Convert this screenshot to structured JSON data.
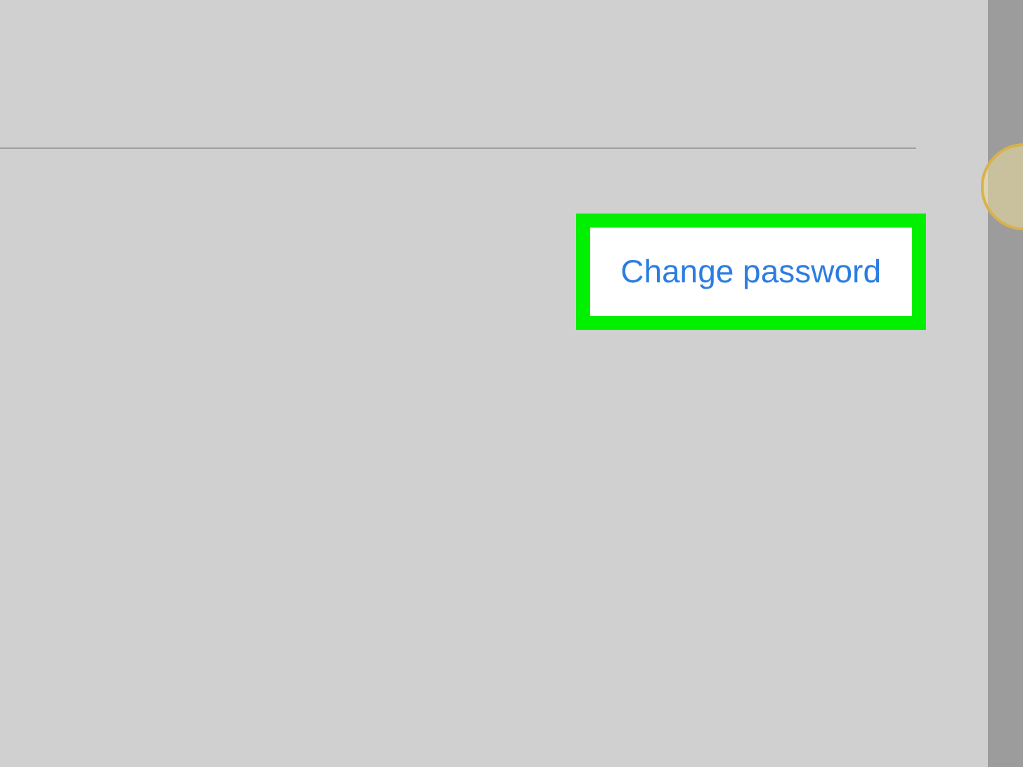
{
  "change_password_link": {
    "label": "Change password",
    "highlighted": true
  }
}
